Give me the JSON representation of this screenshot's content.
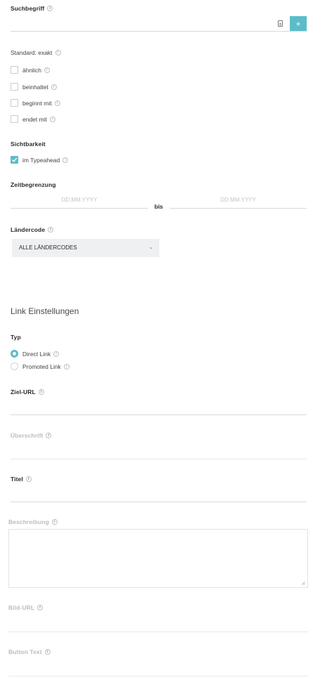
{
  "search": {
    "label": "Suchbegriff",
    "value": "",
    "add_label": "+"
  },
  "match": {
    "default_label": "Standard: exakt",
    "options": [
      {
        "label": "ähnlich",
        "checked": false
      },
      {
        "label": "beinhaltet",
        "checked": false
      },
      {
        "label": "beginnt mit",
        "checked": false
      },
      {
        "label": "endet mit",
        "checked": false
      }
    ]
  },
  "visibility": {
    "heading": "Sichtbarkeit",
    "typeahead_label": "im Typeahead",
    "typeahead_checked": true
  },
  "time_limit": {
    "heading": "Zeitbegrenzung",
    "from_placeholder": "DD.MM.YYYY",
    "to_placeholder": "DD.MM.YYYY",
    "separator": "bis"
  },
  "country": {
    "heading": "Ländercode",
    "selected": "ALLE LÄNDERCODES"
  },
  "link_settings": {
    "title": "Link Einstellungen",
    "type_heading": "Typ",
    "types": [
      {
        "label": "Direct Link",
        "checked": true
      },
      {
        "label": "Promoted Link",
        "checked": false
      }
    ],
    "target_url_label": "Ziel-URL",
    "heading_label": "Überschrift",
    "title_label": "Titel",
    "description_label": "Beschreibung",
    "image_url_label": "Bild-URL",
    "button_text_label": "Button Text"
  },
  "colors": {
    "accent": "#5bbcc9",
    "muted_label": "#b8bcc2"
  }
}
